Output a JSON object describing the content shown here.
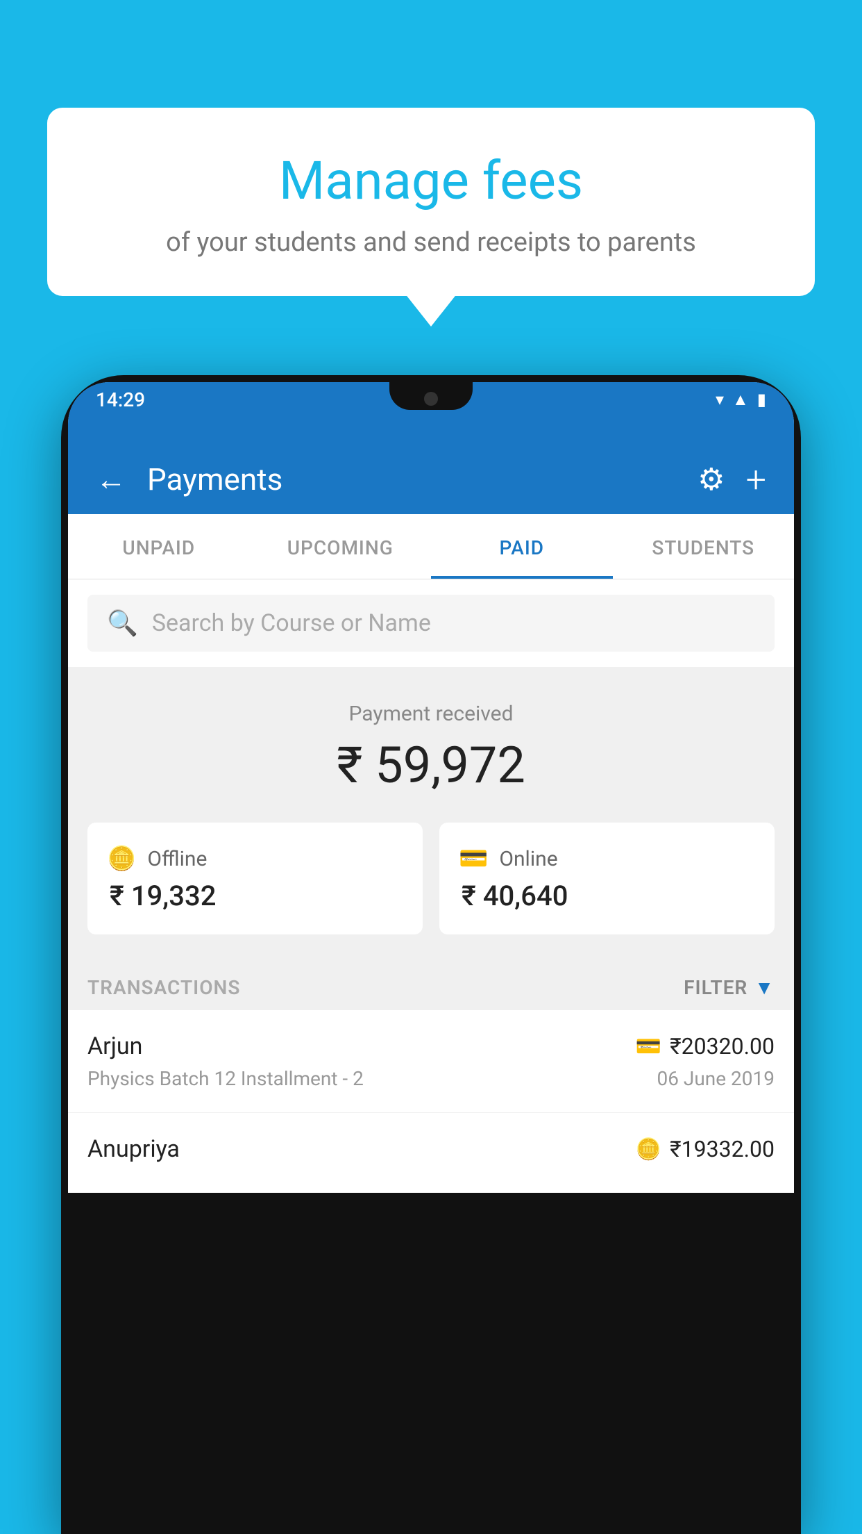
{
  "background": {
    "color": "#1ab8e8"
  },
  "bubble": {
    "title": "Manage fees",
    "subtitle": "of your students and send receipts to parents"
  },
  "phone": {
    "status_time": "14:29",
    "header": {
      "title": "Payments",
      "back_label": "←",
      "gear_label": "⚙",
      "plus_label": "+"
    },
    "tabs": [
      {
        "label": "UNPAID",
        "active": false
      },
      {
        "label": "UPCOMING",
        "active": false
      },
      {
        "label": "PAID",
        "active": true
      },
      {
        "label": "STUDENTS",
        "active": false
      }
    ],
    "search": {
      "placeholder": "Search by Course or Name"
    },
    "payment_summary": {
      "label": "Payment received",
      "amount": "₹ 59,972",
      "offline_label": "Offline",
      "offline_amount": "₹ 19,332",
      "online_label": "Online",
      "online_amount": "₹ 40,640"
    },
    "transactions_label": "TRANSACTIONS",
    "filter_label": "FILTER",
    "transactions": [
      {
        "name": "Arjun",
        "course": "Physics Batch 12 Installment - 2",
        "amount": "₹20320.00",
        "date": "06 June 2019",
        "payment_type": "card"
      },
      {
        "name": "Anupriya",
        "course": "",
        "amount": "₹19332.00",
        "date": "",
        "payment_type": "offline"
      }
    ]
  }
}
